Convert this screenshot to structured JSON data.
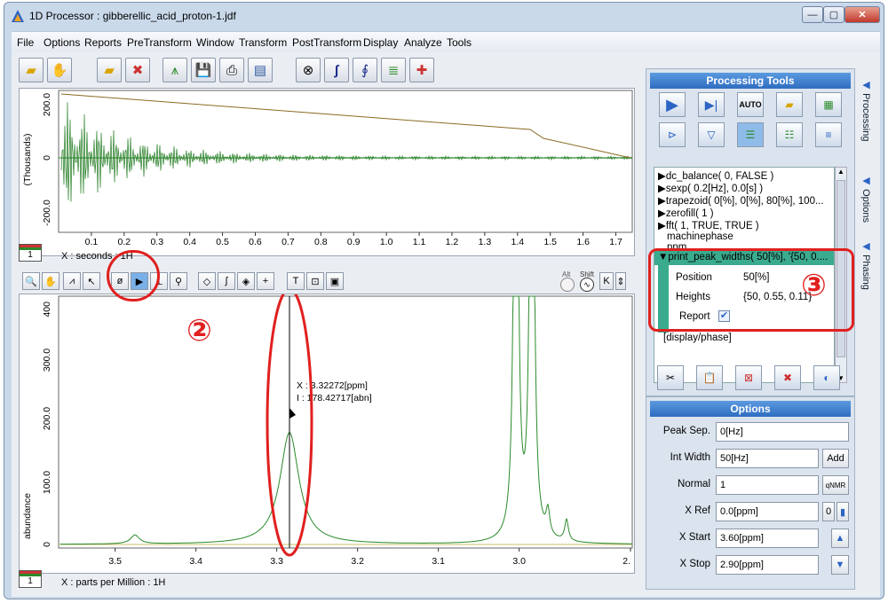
{
  "window": {
    "title": "1D Processor : gibberellic_acid_proton-1.jdf"
  },
  "menu": [
    "File",
    "Options",
    "Reports",
    "PreTransform",
    "Window",
    "Transform",
    "PostTransform",
    "Display",
    "Analyze",
    "Tools"
  ],
  "fid_plot": {
    "y_label": "(Thousands)",
    "y_ticks": [
      "200.0",
      "0",
      "-200.0"
    ],
    "x_ticks": [
      "0.1",
      "0.2",
      "0.3",
      "0.4",
      "0.5",
      "0.6",
      "0.7",
      "0.8",
      "0.9",
      "1.0",
      "1.1",
      "1.2",
      "1.3",
      "1.4",
      "1.5",
      "1.6",
      "1.7"
    ],
    "page_indicator": "1",
    "x_axis_caption": "X : seconds : 1H"
  },
  "spectrum": {
    "y_label": "abundance",
    "y_ticks": [
      "400",
      "300.0",
      "200.0",
      "100.0",
      "0"
    ],
    "x_ticks": [
      "3.5",
      "3.4",
      "3.3",
      "3.2",
      "3.1",
      "3.0",
      "2."
    ],
    "cursor_x": "X : 3.32272[ppm]",
    "cursor_i": "I : 178.42717[abn]",
    "page_indicator": "1",
    "x_axis_caption": "X : parts per Million : 1H",
    "callout": "②",
    "alt_label": "Alt",
    "shift_label": "Shift"
  },
  "processing_tools": {
    "header": "Processing Tools",
    "list": [
      "▶dc_balance( 0, FALSE )",
      "▶sexp( 0.2[Hz], 0.0[s] )",
      "▶trapezoid( 0[%], 0[%], 80[%], 100...",
      "▶zerofill( 1 )",
      "▶fft( 1, TRUE, TRUE )",
      "machinephase",
      "ppm"
    ],
    "selected": "▼print_peak_widths( 50[%], '{50, 0....",
    "params": [
      {
        "name": "Position",
        "value": "50[%]"
      },
      {
        "name": "Heights",
        "value": "{50, 0.55, 0.11}"
      },
      {
        "name": "Report",
        "value": ""
      }
    ],
    "after": "[display/phase]",
    "callout": "③"
  },
  "options": {
    "header": "Options",
    "rows": [
      {
        "label": "Peak Sep.",
        "value": "0[Hz]"
      },
      {
        "label": "Int Width",
        "value": "50[Hz]",
        "button": "Add"
      },
      {
        "label": "Normal",
        "value": "1",
        "button": "qNMR"
      },
      {
        "label": "X Ref",
        "value": "0.0[ppm]",
        "button": "0"
      },
      {
        "label": "X Start",
        "value": "3.60[ppm]"
      },
      {
        "label": "X Stop",
        "value": "2.90[ppm]"
      }
    ]
  },
  "side_tabs": [
    "Processing",
    "Options",
    "Phasing"
  ]
}
